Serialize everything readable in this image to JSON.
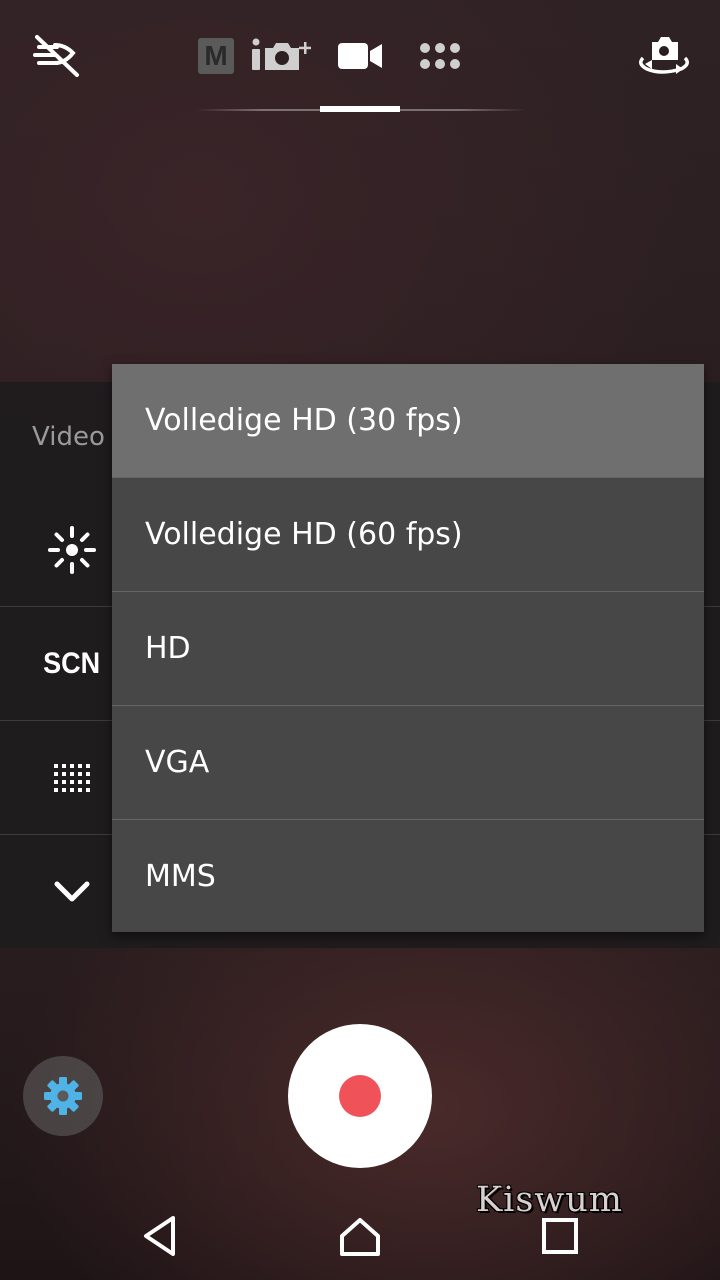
{
  "topbar": {
    "icons": {
      "flash": "flash-off-icon",
      "manual_mode": "manual-mode-icon",
      "superior_auto": "superior-auto-icon",
      "video_mode": "video-camera-icon",
      "apps": "apps-grid-icon",
      "switch_camera": "switch-camera-icon"
    },
    "manual_label": "M",
    "mode_indicator_color": "#ffffff"
  },
  "side_panel": {
    "label": "Video",
    "scene_label": "SCN",
    "icons": {
      "brightness": "brightness-icon",
      "scene": "scene-icon",
      "grid": "grid-icon",
      "expand": "chevron-down-icon"
    }
  },
  "resolution_menu": {
    "items": [
      {
        "label": "Volledige HD (30 fps)",
        "selected": true
      },
      {
        "label": "Volledige HD (60 fps)",
        "selected": false
      },
      {
        "label": "HD",
        "selected": false
      },
      {
        "label": "VGA",
        "selected": false
      },
      {
        "label": "MMS",
        "selected": false
      }
    ]
  },
  "controls": {
    "settings_icon": "gear-icon",
    "record_icon": "record-icon",
    "settings_color": "#4fb3e8",
    "record_color": "#f0525a"
  },
  "watermark": "Kiswum",
  "navbar": {
    "back_icon": "back-icon",
    "home_icon": "home-icon",
    "recents_icon": "recents-icon"
  }
}
